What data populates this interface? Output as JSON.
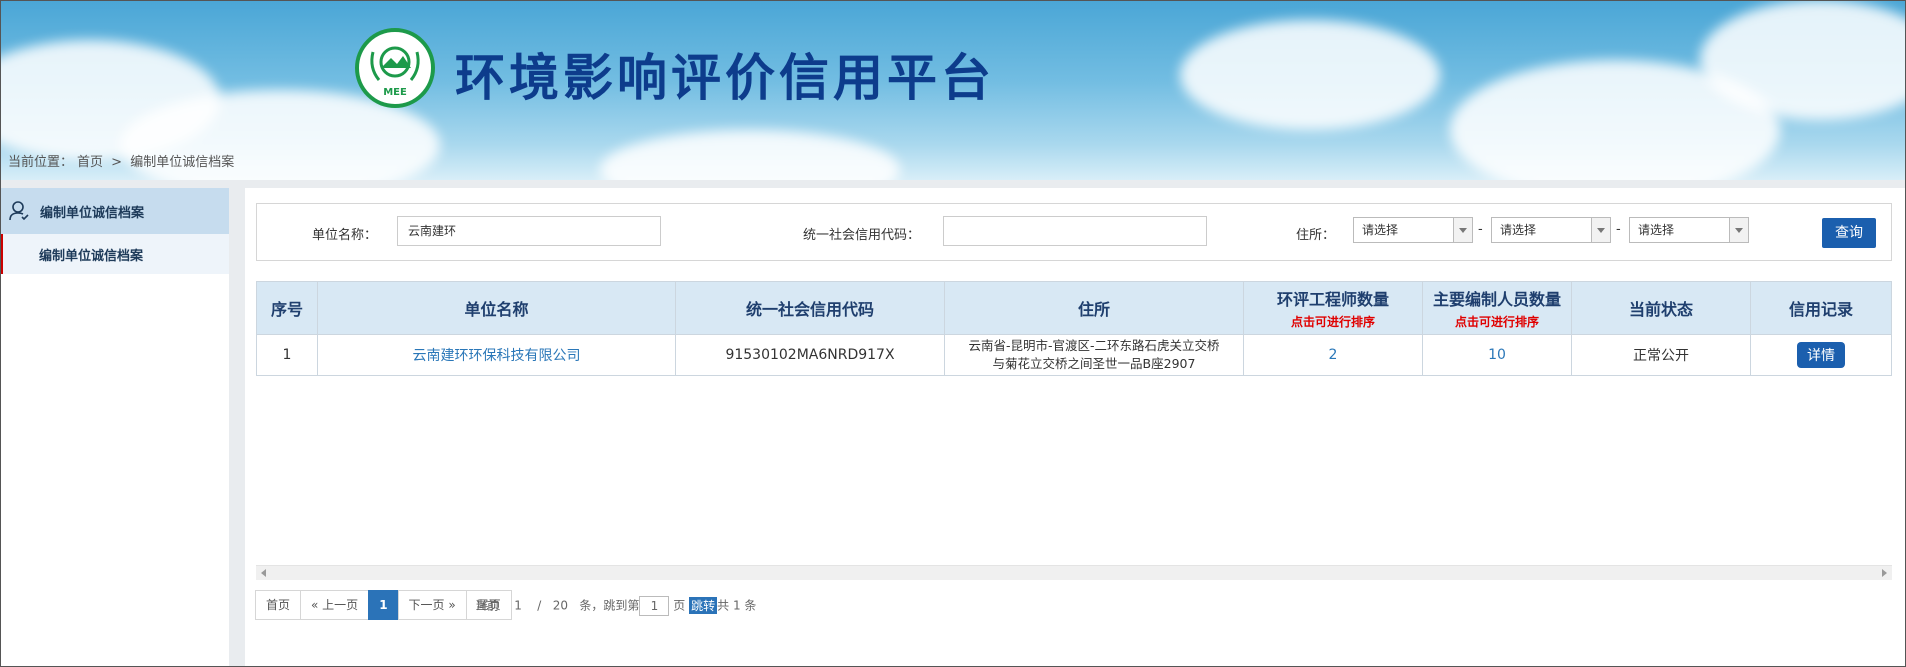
{
  "header": {
    "logo_text": "MEE",
    "site_title": "环境影响评价信用平台"
  },
  "breadcrumb": {
    "prefix": "当前位置：",
    "home": "首页",
    "sep": ">",
    "current": "编制单位诚信档案"
  },
  "sidebar": {
    "title": "编制单位诚信档案",
    "items": [
      {
        "label": "编制单位诚信档案"
      }
    ]
  },
  "search": {
    "unit_name_label": "单位名称：",
    "unit_name_value": "云南建环",
    "credit_code_label": "统一社会信用代码：",
    "credit_code_value": "",
    "address_label": "住所：",
    "province": "请选择",
    "city": "请选择",
    "district": "请选择",
    "dash": "-",
    "query_label": "查询"
  },
  "table": {
    "headers": {
      "index": "序号",
      "unit_name": "单位名称",
      "credit_code": "统一社会信用代码",
      "address": "住所",
      "engineers": "环评工程师数量",
      "engineers_sub": "点击可进行排序",
      "editors": "主要编制人员数量",
      "editors_sub": "点击可进行排序",
      "status": "当前状态",
      "credit_record": "信用记录"
    },
    "rows": [
      {
        "index": "1",
        "unit_name": "云南建环环保科技有限公司",
        "credit_code": "91530102MA6NRD917X",
        "address_line1": "云南省-昆明市-官渡区-二环东路石虎关立交桥",
        "address_line2": "与菊花立交桥之间圣世一品B座2907",
        "engineers": "2",
        "editors": "10",
        "status": "正常公开",
        "detail_label": "详情"
      }
    ]
  },
  "pager": {
    "first": "首页",
    "prev": "« 上一页",
    "current_page": "1",
    "next": "下一页 »",
    "last": "尾页",
    "current_label": "当前",
    "page_now": "1",
    "slash": "/",
    "page_size": "20",
    "jump_prefix": "条，跳到第",
    "jump_value": "1",
    "jump_suffix": "页",
    "jump_btn": "跳转",
    "total": "共 1 条"
  },
  "colors": {
    "title_blue": "#0d3c8c",
    "button_blue": "#1b5fae",
    "link_blue": "#2a77b8",
    "sort_hint_red": "#e00000",
    "header_row_bg": "#d8e8f4"
  }
}
